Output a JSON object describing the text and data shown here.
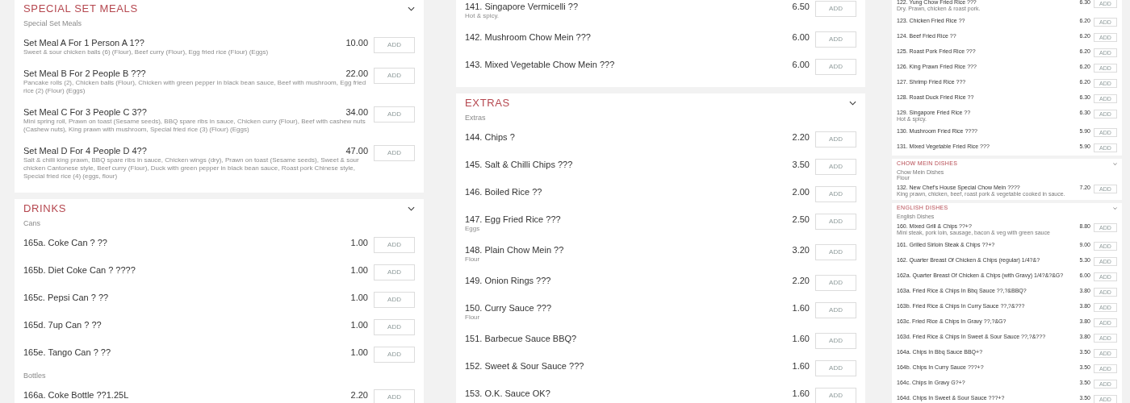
{
  "columns": [
    {
      "kind": "full",
      "sections": [
        {
          "title": "SPECIAL SET MEALS",
          "groups": [
            {
              "heading": "Special Set Meals",
              "items": [
                {
                  "name": "Set Meal A For 1 Person A 1??",
                  "description": "Sweet & sour chicken balls (6) (Flour), Beef curry (Flour), Egg fried rice (Flour) (Eggs)",
                  "price": "10.00",
                  "button": "ADD"
                },
                {
                  "name": "Set Meal B For 2 People B ???",
                  "description": "Pancake rolls (2), Chicken balls (Flour), Chicken with green pepper in black bean sauce, Beef with mushroom, Egg fried rice (2) (Flour) (Eggs)",
                  "price": "22.00",
                  "button": "ADD"
                },
                {
                  "name": "Set Meal C For 3 People C 3??",
                  "description": "Mini spring roll, Prawn on toast (Sesame seeds), BBQ spare ribs in sauce, Chicken curry (Flour), Beef with cashew nuts (Cashew nuts), King prawn with mushroom, Special fried rice (3) (Flour) (Eggs)",
                  "price": "34.00",
                  "button": "ADD"
                },
                {
                  "name": "Set Meal D For 4 People D 4??",
                  "description": "Salt & chilli king prawn, BBQ spare ribs in sauce, Chicken wings (dry), Prawn on toast (Sesame seeds), Sweet & sour chicken Cantonese style, Beef curry (Flour), Duck with green pepper in black bean sauce, Roast pork Chinese style, Special fried rice (4) (eggs, flour)",
                  "price": "47.00",
                  "button": "ADD"
                }
              ]
            }
          ]
        },
        {
          "title": "DRINKS",
          "groups": [
            {
              "heading": "Cans",
              "items": [
                {
                  "name": "165a. Coke Can ? ??",
                  "price": "1.00",
                  "button": "ADD"
                },
                {
                  "name": "165b. Diet Coke Can ? ????",
                  "price": "1.00",
                  "button": "ADD"
                },
                {
                  "name": "165c. Pepsi Can ? ??",
                  "price": "1.00",
                  "button": "ADD"
                },
                {
                  "name": "165d. 7up Can ? ??",
                  "price": "1.00",
                  "button": "ADD"
                },
                {
                  "name": "165e. Tango Can ? ??",
                  "price": "1.00",
                  "button": "ADD"
                }
              ]
            },
            {
              "heading": "Bottles",
              "items": [
                {
                  "name": "166a. Coke Bottle ??1.25L",
                  "price": "2.20",
                  "button": "ADD"
                }
              ]
            }
          ]
        }
      ]
    },
    {
      "kind": "full",
      "sections": [
        {
          "groups": [
            {
              "items": [
                {
                  "name": "141. Singapore Vermicelli ??",
                  "description": "Hot & spicy.",
                  "price": "6.50",
                  "button": "ADD"
                },
                {
                  "name": "142. Mushroom Chow Mein ???",
                  "price": "6.00",
                  "button": "ADD"
                },
                {
                  "name": "143. Mixed Vegetable Chow Mein ???",
                  "price": "6.00",
                  "button": "ADD"
                }
              ]
            }
          ]
        },
        {
          "title": "EXTRAS",
          "groups": [
            {
              "heading": "Extras",
              "items": [
                {
                  "name": "144. Chips ?",
                  "price": "2.20",
                  "button": "ADD"
                },
                {
                  "name": "145. Salt & Chilli Chips ???",
                  "price": "3.50",
                  "button": "ADD"
                },
                {
                  "name": "146. Boiled Rice ??",
                  "price": "2.00",
                  "button": "ADD"
                },
                {
                  "name": "147. Egg Fried Rice ???",
                  "description": "Eggs",
                  "price": "2.50",
                  "button": "ADD"
                },
                {
                  "name": "148. Plain Chow Mein ??",
                  "description": "Flour",
                  "price": "3.20",
                  "button": "ADD"
                },
                {
                  "name": "149. Onion Rings ???",
                  "price": "2.20",
                  "button": "ADD"
                },
                {
                  "name": "150. Curry Sauce ???",
                  "description": "Flour",
                  "price": "1.60",
                  "button": "ADD"
                },
                {
                  "name": "151. Barbecue Sauce BBQ?",
                  "price": "1.60",
                  "button": "ADD"
                },
                {
                  "name": "152. Sweet & Sour Sauce ???",
                  "price": "1.60",
                  "button": "ADD"
                },
                {
                  "name": "153. O.K. Sauce OK?",
                  "price": "1.60",
                  "button": "ADD"
                }
              ]
            }
          ]
        }
      ]
    },
    {
      "kind": "mini",
      "sections": [
        {
          "groups": [
            {
              "items": [
                {
                  "name": "122. Yung Chow Fried Rice ???",
                  "description": "Dry. Prawn, chicken & roast pork.",
                  "price": "6.30",
                  "button": "ADD"
                },
                {
                  "name": "123. Chicken Fried Rice ??",
                  "price": "6.20",
                  "button": "ADD"
                },
                {
                  "name": "124. Beef Fried Rice ??",
                  "price": "6.20",
                  "button": "ADD"
                },
                {
                  "name": "125. Roast Pork Fried Rice ???",
                  "price": "6.20",
                  "button": "ADD"
                },
                {
                  "name": "126. King Prawn Fried Rice ???",
                  "price": "6.20",
                  "button": "ADD"
                },
                {
                  "name": "127. Shrimp Fried Rice ???",
                  "price": "6.20",
                  "button": "ADD"
                },
                {
                  "name": "128. Roast Duck Fried Rice ??",
                  "price": "6.30",
                  "button": "ADD"
                },
                {
                  "name": "129. Singapore Fried Rice ??",
                  "description": "Hot & spicy.",
                  "price": "6.30",
                  "button": "ADD"
                },
                {
                  "name": "130. Mushroom Fried Rice ????",
                  "price": "5.90",
                  "button": "ADD"
                },
                {
                  "name": "131. Mixed Vegetable Fried Rice ???",
                  "price": "5.90",
                  "button": "ADD"
                }
              ]
            }
          ]
        },
        {
          "title": "CHOW MEIN DISHES",
          "groups": [
            {
              "heading": "Chow Mein Dishes",
              "note": "Flour",
              "items": [
                {
                  "name": "132. New Chef's House Special Chow Mein ????",
                  "description": "King prawn, chicken, beef, roast pork & vegetable cooked in sauce.",
                  "price": "7.20",
                  "button": "ADD"
                }
              ]
            }
          ]
        },
        {
          "title": "ENGLISH DISHES",
          "groups": [
            {
              "heading": "English Dishes",
              "items": [
                {
                  "name": "160. Mixed Grill & Chips ??+?",
                  "description": "Mini steak, pork loin, sausage, bacon & veg with green sauce",
                  "price": "8.80",
                  "button": "ADD"
                },
                {
                  "name": "161. Grilled Sirloin Steak & Chips ??+?",
                  "price": "9.00",
                  "button": "ADD"
                },
                {
                  "name": "162. Quarter Breast Of Chicken & Chips (regular) 1/4?&?",
                  "price": "5.30",
                  "button": "ADD"
                },
                {
                  "name": "162a. Quarter Breast Of Chicken & Chips (with Gravy) 1/4?&?&G?",
                  "price": "6.00",
                  "button": "ADD"
                },
                {
                  "name": "163a. Fried Rice & Chips In Bbq Sauce ??,?&BBQ?",
                  "price": "3.80",
                  "button": "ADD"
                },
                {
                  "name": "163b. Fried Rice & Chips In Curry Sauce ??,?&???",
                  "price": "3.80",
                  "button": "ADD"
                },
                {
                  "name": "163c. Fried Rice & Chips In Gravy ??,?&G?",
                  "price": "3.80",
                  "button": "ADD"
                },
                {
                  "name": "163d. Fried Rice & Chips In Sweet & Sour Sauce ??,?&???",
                  "price": "3.80",
                  "button": "ADD"
                },
                {
                  "name": "164a. Chips In Bbq Sauce BBQ+?",
                  "price": "3.50",
                  "button": "ADD"
                },
                {
                  "name": "164b. Chips In Curry Sauce ???+?",
                  "price": "3.50",
                  "button": "ADD"
                },
                {
                  "name": "164c. Chips In Gravy G?+?",
                  "price": "3.50",
                  "button": "ADD"
                },
                {
                  "name": "164d. Chips In Sweet & Sour Sauce ???+?",
                  "price": "3.50",
                  "button": "ADD"
                }
              ]
            }
          ]
        }
      ]
    }
  ]
}
